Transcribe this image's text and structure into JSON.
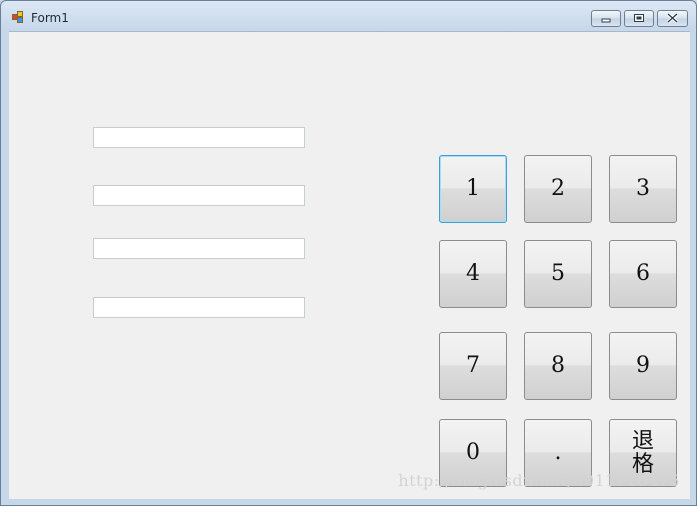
{
  "window": {
    "title": "Form1",
    "icon": "windows-form-icon",
    "controls": {
      "minimize_icon": "minimize-icon",
      "maximize_icon": "maximize-icon",
      "close_icon": "close-icon"
    }
  },
  "textboxes": [
    {
      "value": "",
      "placeholder": ""
    },
    {
      "value": "",
      "placeholder": ""
    },
    {
      "value": "",
      "placeholder": ""
    },
    {
      "value": "",
      "placeholder": ""
    }
  ],
  "keypad": {
    "keys": [
      "1",
      "2",
      "3",
      "4",
      "5",
      "6",
      "7",
      "8",
      "9",
      "0",
      ".",
      "退\n格"
    ],
    "focused_key": "1"
  },
  "watermark": "http://blog.csdn.net/u011710475",
  "colors": {
    "focus_border": "#3c9fd6",
    "client_background": "#f0f0f0",
    "titlebar": "#c6d7ea"
  }
}
